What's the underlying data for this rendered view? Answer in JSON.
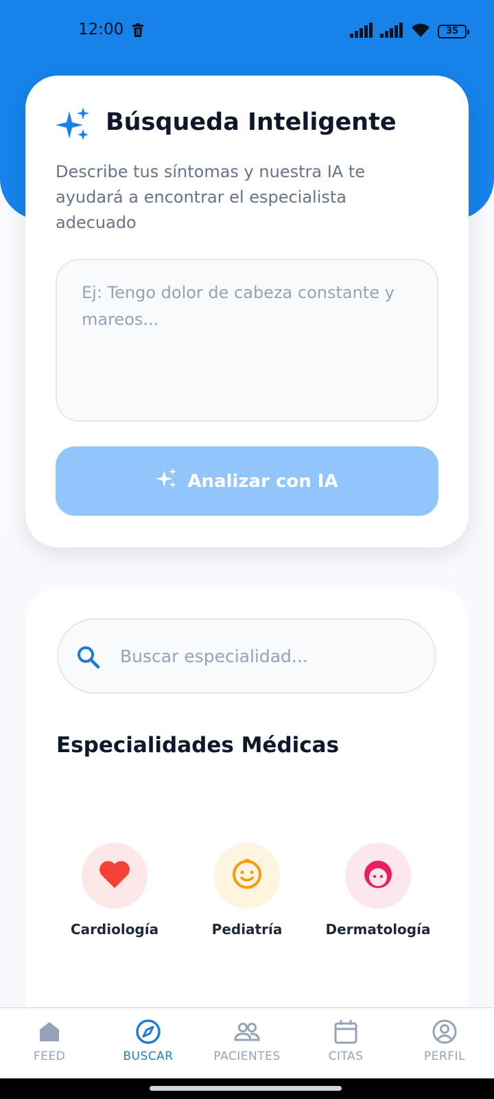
{
  "status_bar": {
    "time": "12:00",
    "battery": "35"
  },
  "ai_search": {
    "title": "Búsqueda Inteligente",
    "description": "Describe tus síntomas y nuestra IA te ayudará a encontrar el especialista adecuado",
    "input_placeholder": "Ej: Tengo dolor de cabeza constante y mareos...",
    "input_value": "",
    "analyze_label": "Analizar con IA"
  },
  "specialties": {
    "search_placeholder": "Buscar especialidad...",
    "search_value": "",
    "title": "Especialidades Médicas",
    "items": [
      {
        "label": "Cardiología",
        "icon": "heart-icon",
        "color": "#f44336",
        "bg": "#fde8e8"
      },
      {
        "label": "Pediatría",
        "icon": "baby-face-icon",
        "color": "#f59e0b",
        "bg": "#fff4e0"
      },
      {
        "label": "Dermatología",
        "icon": "face-icon",
        "color": "#e91e63",
        "bg": "#fde7ef"
      }
    ]
  },
  "bottom_nav": {
    "items": [
      {
        "label": "FEED",
        "icon": "home-icon",
        "active": false
      },
      {
        "label": "BUSCAR",
        "icon": "compass-icon",
        "active": true
      },
      {
        "label": "PACIENTES",
        "icon": "people-icon",
        "active": false
      },
      {
        "label": "CITAS",
        "icon": "calendar-icon",
        "active": false
      },
      {
        "label": "PERFIL",
        "icon": "profile-icon",
        "active": false
      }
    ]
  },
  "colors": {
    "primary": "#1682ea",
    "button_disabled": "#93c5fd",
    "nav_active": "#1e7bd1",
    "nav_inactive": "#94a3b8"
  }
}
